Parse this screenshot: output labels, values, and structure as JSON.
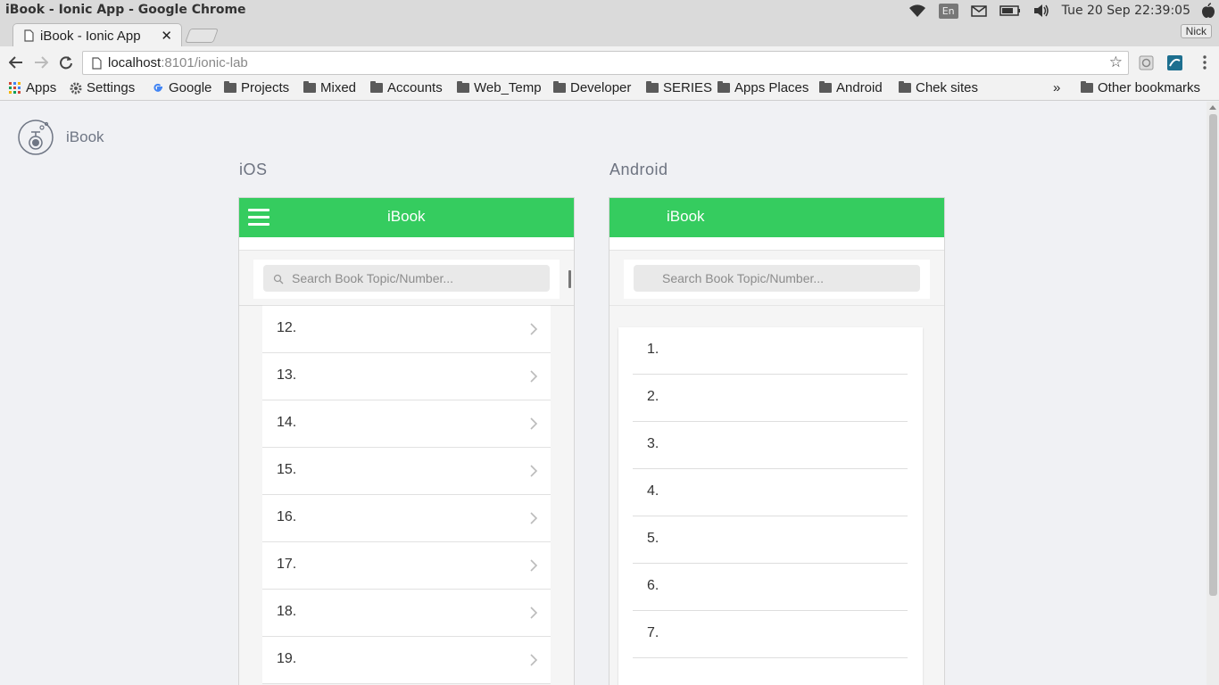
{
  "os_bar": {
    "window_title": "iBook - Ionic App - Google Chrome",
    "lang": "En",
    "clock": "Tue 20 Sep 22:39:05"
  },
  "browser": {
    "tab_title": "iBook - Ionic App",
    "profile": "Nick",
    "url_host": "localhost",
    "url_path": ":8101/ionic-lab"
  },
  "bookmarks": {
    "items": [
      "Apps",
      "Settings",
      "Google",
      "Projects",
      "Mixed",
      "Accounts",
      "Web_Temp",
      "Developer",
      "SERIES",
      "Apps Places",
      "Android",
      "Chek sites"
    ],
    "overflow": "»",
    "other": "Other bookmarks"
  },
  "lab": {
    "brand": "iBook",
    "ios_label": "iOS",
    "android_label": "Android"
  },
  "ios": {
    "header_title": "iBook",
    "search_placeholder": "Search Book Topic/Number...",
    "items": [
      "12.",
      "13.",
      "14.",
      "15.",
      "16.",
      "17.",
      "18.",
      "19."
    ]
  },
  "android": {
    "header_title": "iBook",
    "search_placeholder": "Search Book Topic/Number...",
    "items": [
      "1.",
      "2.",
      "3.",
      "4.",
      "5.",
      "6.",
      "7."
    ]
  },
  "colors": {
    "header_green": "#35cc5f"
  }
}
